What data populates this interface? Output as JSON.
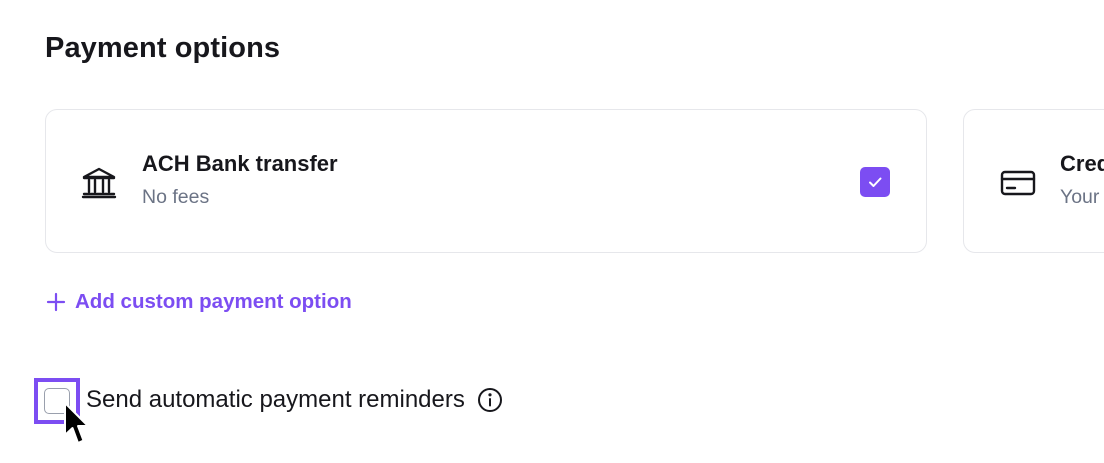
{
  "section": {
    "title": "Payment options"
  },
  "payment_cards": [
    {
      "name": "ACH Bank transfer",
      "subtitle": "No fees",
      "icon": "bank-icon",
      "selected": true
    },
    {
      "name": "Cred",
      "subtitle": "Your",
      "icon": "credit-card-icon"
    }
  ],
  "add_option": {
    "label": "Add custom payment option",
    "icon": "plus-icon"
  },
  "reminders": {
    "label": "Send automatic payment reminders",
    "checked": false,
    "icon": "info-icon"
  },
  "colors": {
    "accent": "#7c4df2",
    "text": "#17171c",
    "muted": "#6b7385",
    "border": "#e6e7eb"
  }
}
